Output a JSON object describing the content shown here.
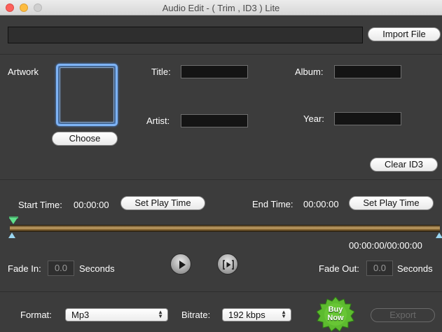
{
  "window": {
    "title": "Audio Edit - ( Trim , ID3 ) Lite"
  },
  "file": {
    "path_value": "",
    "import_label": "Import File"
  },
  "id3": {
    "artwork_label": "Artwork",
    "choose_label": "Choose",
    "title_label": "Title:",
    "title_value": "",
    "album_label": "Album:",
    "album_value": "",
    "artist_label": "Artist:",
    "artist_value": "",
    "year_label": "Year:",
    "year_value": "",
    "clear_label": "Clear ID3"
  },
  "trim": {
    "start_label": "Start Time:",
    "start_value": "00:00:00",
    "start_set_label": "Set Play Time",
    "end_label": "End Time:",
    "end_value": "00:00:00",
    "end_set_label": "Set Play Time",
    "position_readout": "00:00:00/00:00:00"
  },
  "fade": {
    "in_label": "Fade In:",
    "in_value": "0.0",
    "in_unit": "Seconds",
    "out_label": "Fade Out:",
    "out_value": "0.0",
    "out_unit": "Seconds"
  },
  "playback": {
    "play_icon": "play-icon",
    "preview_icon": "play-selection-icon"
  },
  "output": {
    "format_label": "Format:",
    "format_value": "Mp3",
    "bitrate_label": "Bitrate:",
    "bitrate_value": "192 kbps",
    "buy_line1": "Buy",
    "buy_line2": "Now",
    "export_label": "Export"
  },
  "colors": {
    "background": "#3c3c3c",
    "artwork_focus": "#7eb3f5",
    "timeline": "#c6a469",
    "start_marker": "#5fe08a",
    "buy_badge": "#5dbb2f"
  }
}
